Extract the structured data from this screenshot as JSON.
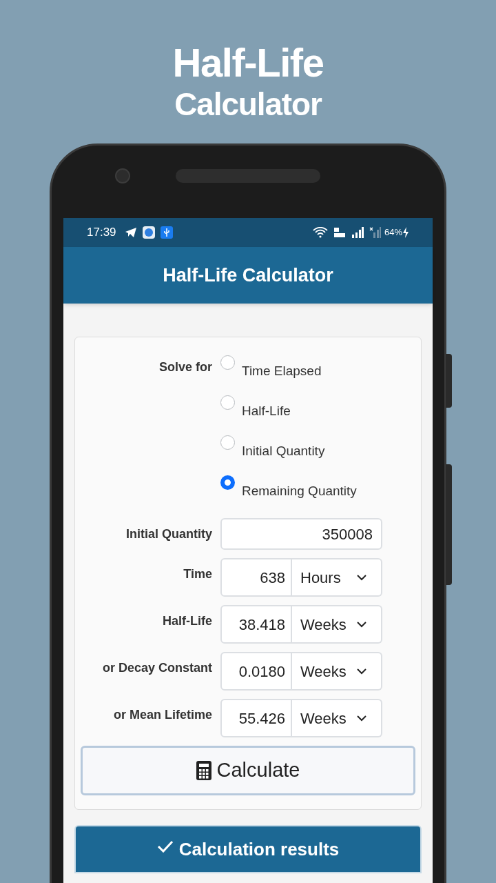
{
  "promo_title": {
    "line_1": "Half-Life",
    "line_2": "Calculator"
  },
  "status_bar": {
    "time": "17:39",
    "battery": "64%"
  },
  "app_bar": {
    "title": "Half-Life Calculator"
  },
  "solve_for": {
    "label": "Solve for",
    "options": [
      {
        "label": "Time Elapsed",
        "selected": false
      },
      {
        "label": "Half-Life",
        "selected": false
      },
      {
        "label": "Initial Quantity",
        "selected": false
      },
      {
        "label": "Remaining Quantity",
        "selected": true
      }
    ]
  },
  "fields": [
    {
      "kind": "plain",
      "label": "Initial Quantity",
      "value": "350008"
    },
    {
      "kind": "unit",
      "label": "Time",
      "value": "638",
      "unit": "Hours"
    },
    {
      "kind": "unit",
      "label": "Half-Life",
      "value": "38.418",
      "unit": "Weeks"
    },
    {
      "kind": "unit",
      "label": "or Decay Constant",
      "value": "0.0180",
      "unit": "Weeks"
    },
    {
      "kind": "unit",
      "label": "or Mean Lifetime",
      "value": "55.426",
      "unit": "Weeks"
    }
  ],
  "calculate_button": "Calculate",
  "results_header": "Calculation results"
}
